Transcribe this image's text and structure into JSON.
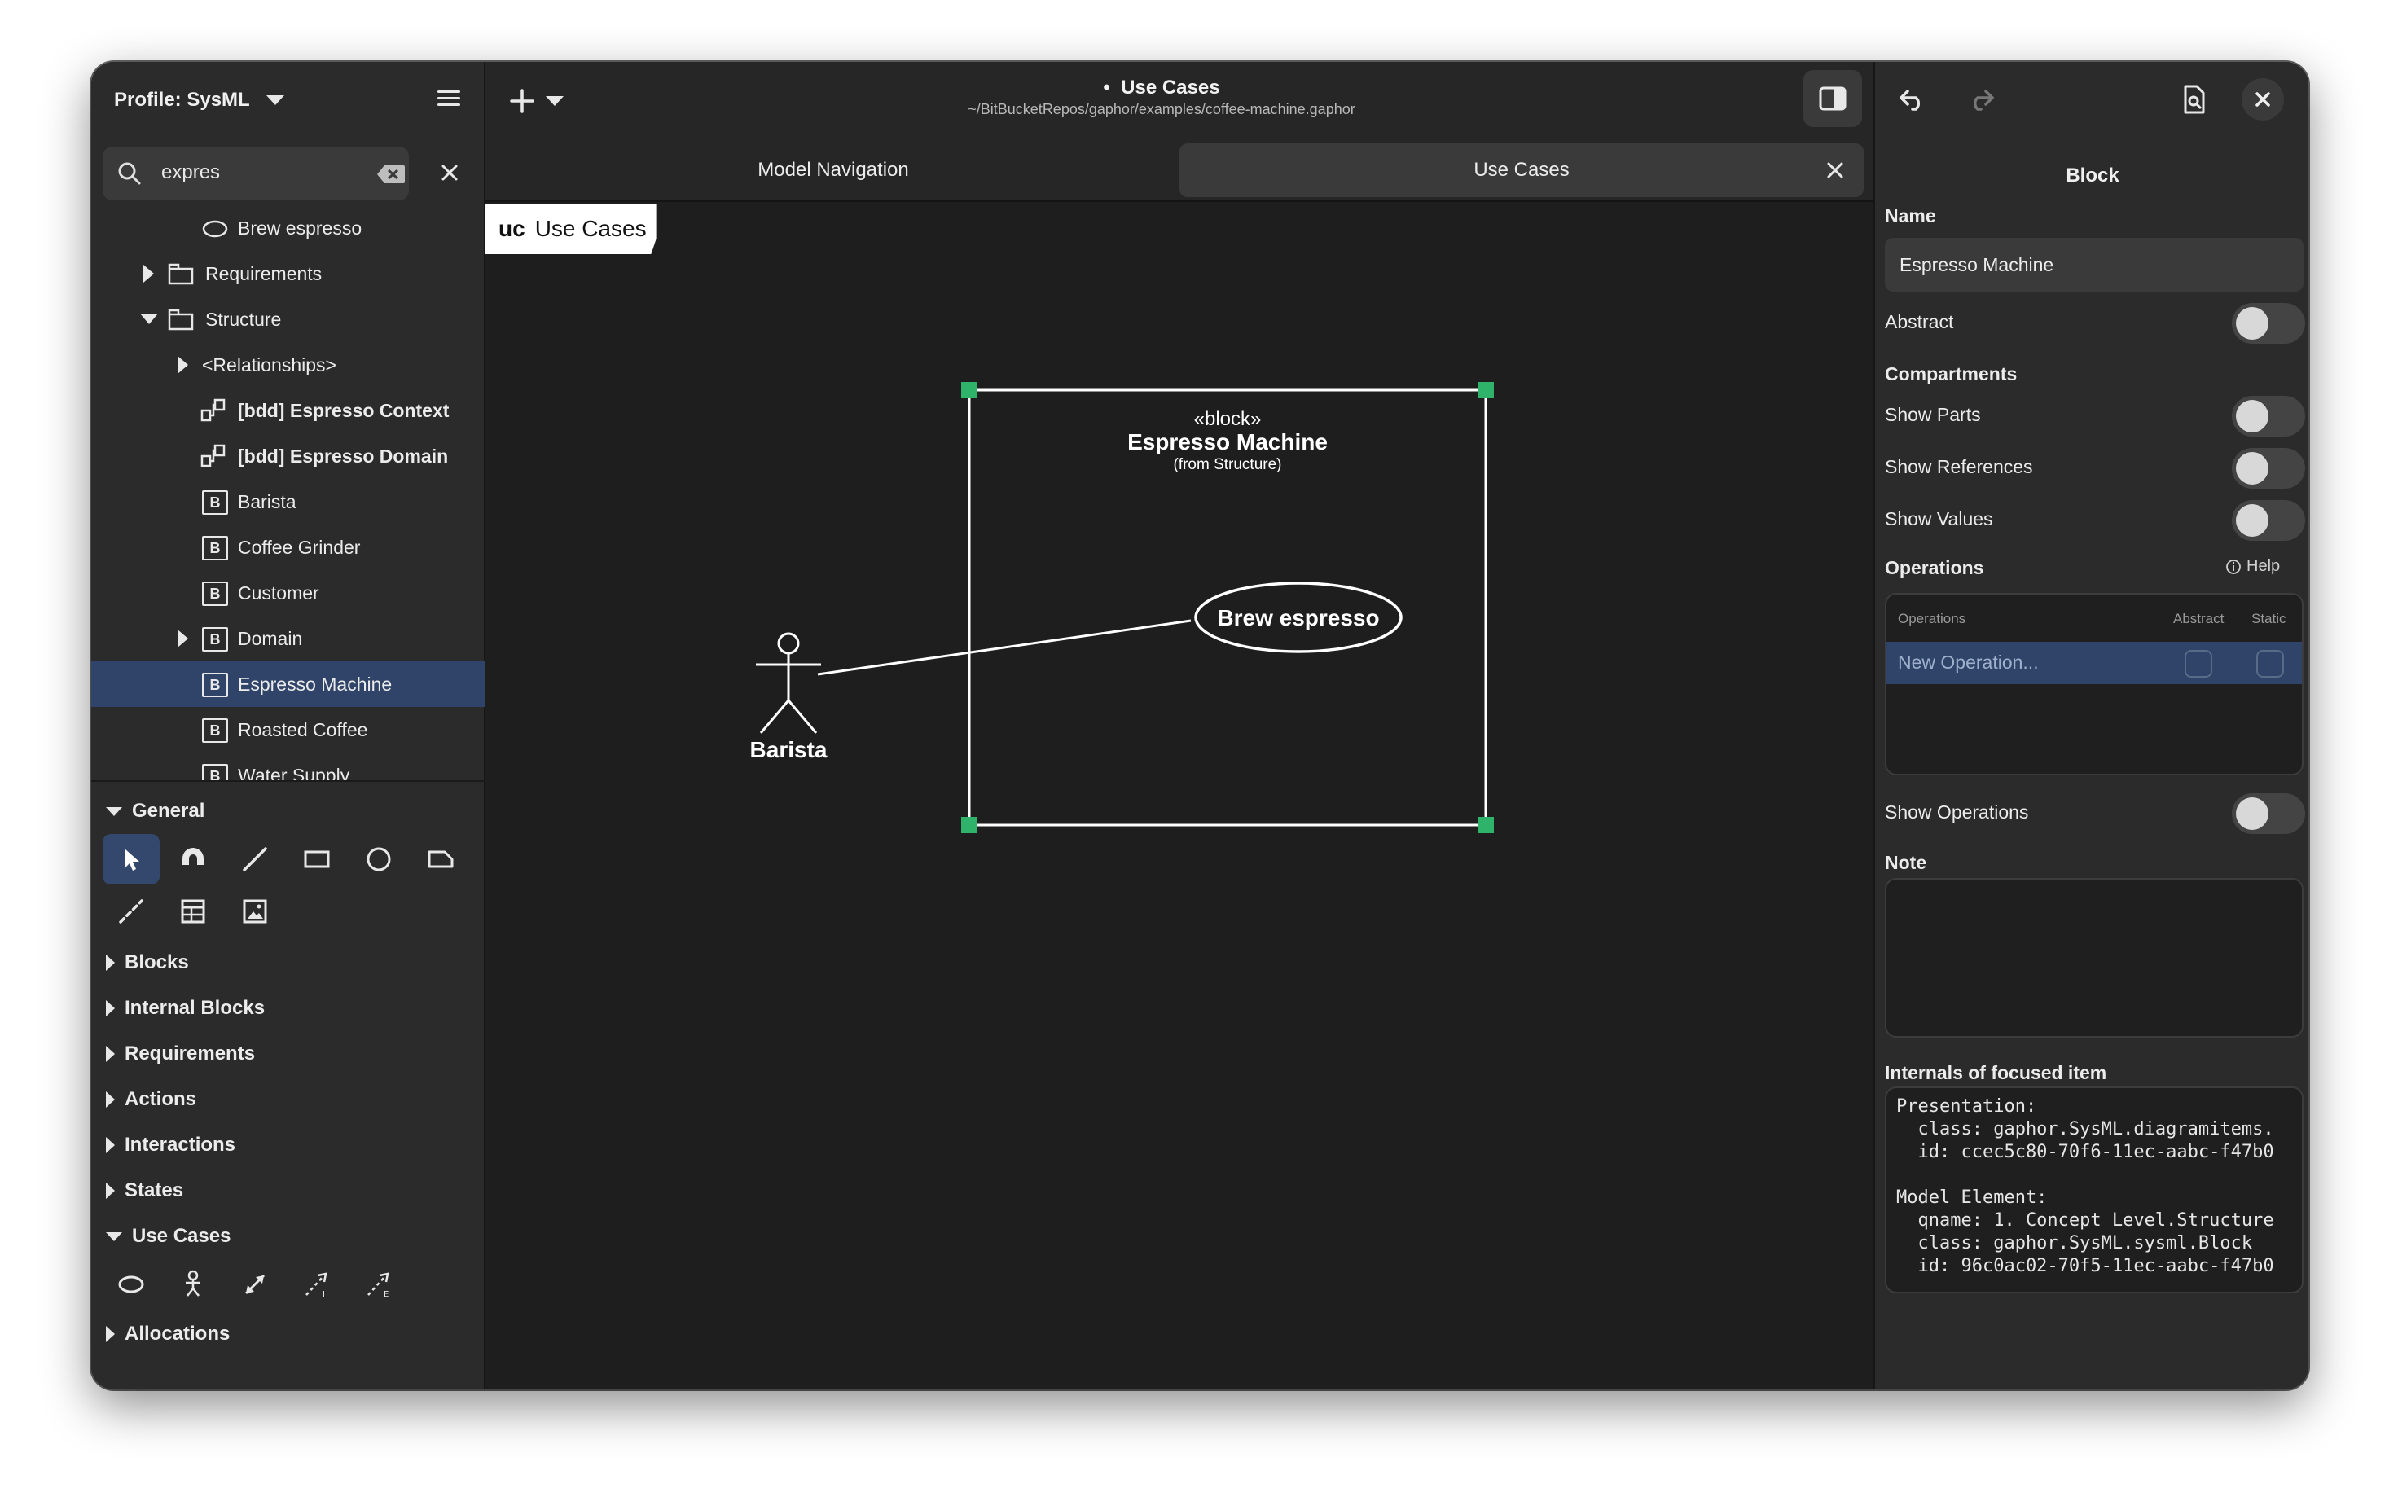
{
  "sidebar": {
    "profile_label": "Profile: SysML",
    "search": {
      "value": "expres"
    },
    "tree": [
      {
        "label": "Brew espresso",
        "icon": "usecase-ellipse-icon"
      },
      {
        "label": "Requirements",
        "icon": "package-icon",
        "expander": "collapsed"
      },
      {
        "label": "Structure",
        "icon": "package-icon",
        "expander": "expanded"
      },
      {
        "label": "<Relationships>",
        "expander": "collapsed"
      },
      {
        "label": "[bdd] Espresso Context",
        "icon": "diagram-icon"
      },
      {
        "label": "[bdd] Espresso Domain",
        "icon": "diagram-icon"
      },
      {
        "label": "Barista",
        "icon": "block-icon",
        "icon_letter": "B"
      },
      {
        "label": "Coffee Grinder",
        "icon": "block-icon",
        "icon_letter": "B"
      },
      {
        "label": "Customer",
        "icon": "block-icon",
        "icon_letter": "B"
      },
      {
        "label": "Domain",
        "icon": "block-icon",
        "icon_letter": "B",
        "expander": "collapsed"
      },
      {
        "label": "Espresso Machine",
        "icon": "block-icon",
        "icon_letter": "B",
        "selected": true
      },
      {
        "label": "Roasted Coffee",
        "icon": "block-icon",
        "icon_letter": "B"
      },
      {
        "label": "Water Supply",
        "icon": "block-icon",
        "icon_letter": "B"
      }
    ]
  },
  "toolbox": {
    "sections": [
      {
        "label": "General",
        "expanded": true
      },
      {
        "label": "Blocks",
        "expanded": false
      },
      {
        "label": "Internal Blocks",
        "expanded": false
      },
      {
        "label": "Requirements",
        "expanded": false
      },
      {
        "label": "Actions",
        "expanded": false
      },
      {
        "label": "Interactions",
        "expanded": false
      },
      {
        "label": "States",
        "expanded": false
      },
      {
        "label": "Use Cases",
        "expanded": true
      },
      {
        "label": "Allocations",
        "expanded": false
      }
    ],
    "general_tools": [
      "pointer-icon",
      "magnet-icon",
      "line-icon",
      "box-icon",
      "ellipse-icon",
      "comment-icon",
      "comment-line-icon",
      "table-icon",
      "image-icon"
    ],
    "usecase_tools": [
      "usecase-icon",
      "actor-icon",
      "association-icon",
      "include-icon",
      "extend-icon"
    ]
  },
  "header": {
    "title": "Use Cases",
    "path": "~/BitBucketRepos/gaphor/examples/coffee-machine.gaphor",
    "modified_marker": "•"
  },
  "tabs": [
    {
      "label": "Model Navigation",
      "active": false
    },
    {
      "label": "Use Cases",
      "active": true,
      "closable": true
    }
  ],
  "diagram": {
    "kind_label": "uc",
    "name_label": "Use Cases",
    "block": {
      "stereotype": "«block»",
      "name": "Espresso Machine",
      "from": "(from Structure)"
    },
    "usecase": {
      "name": "Brew espresso"
    },
    "actor": {
      "name": "Barista"
    },
    "colors": {
      "handle": "#2fb36b",
      "stroke": "#ffffff",
      "background": "#1e1e1e"
    }
  },
  "properties": {
    "title": "Block",
    "name_label": "Name",
    "name_value": "Espresso Machine",
    "abstract_label": "Abstract",
    "compartments_label": "Compartments",
    "show_parts": "Show Parts",
    "show_references": "Show References",
    "show_values": "Show Values",
    "operations_label": "Operations",
    "help_label": "Help",
    "ops_columns": {
      "name": "Operations",
      "abstract": "Abstract",
      "static": "Static"
    },
    "new_operation": "New Operation...",
    "show_operations": "Show Operations",
    "note_label": "Note",
    "internals_label": "Internals of focused item",
    "internals_lines": [
      "Presentation:",
      "  class: gaphor.SysML.diagramitems.",
      "  id: ccec5c80-70f6-11ec-aabc-f47b0",
      "",
      "Model Element:",
      "  qname: 1. Concept Level.Structure",
      "  class: gaphor.SysML.sysml.Block",
      "  id: 96c0ac02-70f5-11ec-aabc-f47b0"
    ]
  }
}
